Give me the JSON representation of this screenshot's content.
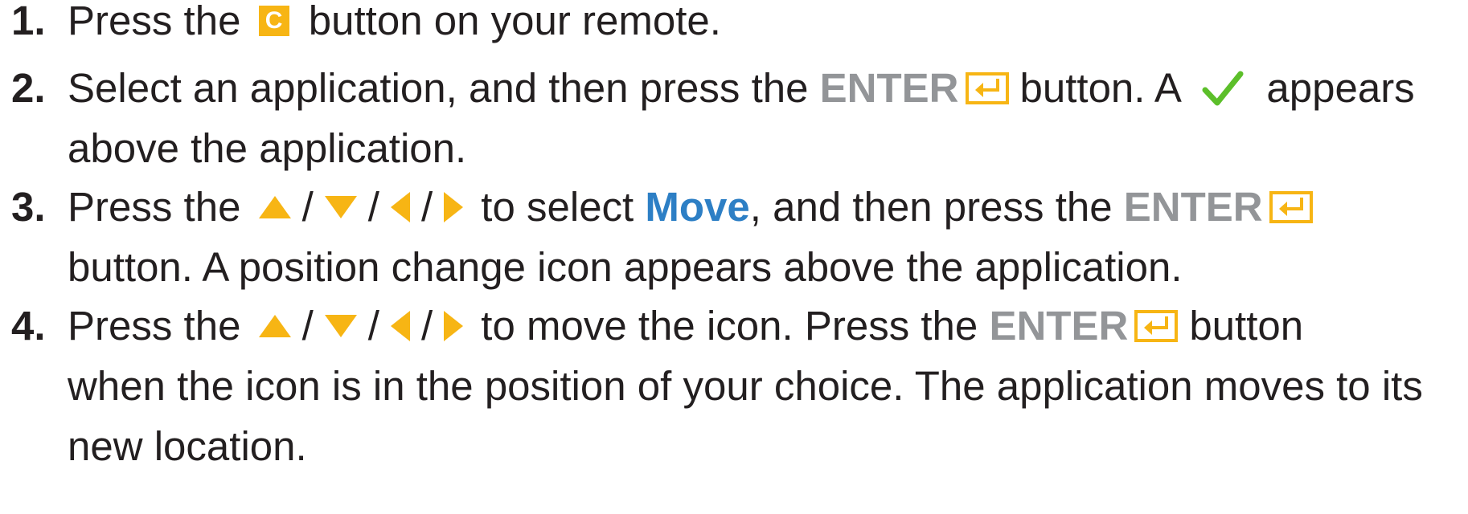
{
  "steps": [
    {
      "number": "1.",
      "text_before_key": "Press the",
      "color_key_label": "C",
      "text_after_key": "button on your remote."
    },
    {
      "number": "2.",
      "text_before_enter": "Select an application, and then press the",
      "enter_label": "ENTER",
      "text_after_enter": "button. A",
      "text_after_check": "appears",
      "line2": "above the application."
    },
    {
      "number": "3.",
      "text_start": "Press the",
      "separator": "/",
      "text_select": "to select",
      "move_label": "Move",
      "text_after_move": ", and then press the",
      "enter_label": "ENTER",
      "line2": "button. A position change icon appears above the application."
    },
    {
      "number": "4.",
      "text_start": "Press the",
      "separator": "/",
      "text_after_arrows": "to move the icon. Press the",
      "enter_label": "ENTER",
      "text_after_enter": "button",
      "line2": "when the icon is in the position of your choice. The application moves to its",
      "line3": "new location."
    }
  ],
  "icons": {
    "color_key": "c-color-key-icon",
    "enter": "enter-key-icon",
    "check": "checkmark-icon",
    "up": "arrow-up-icon",
    "down": "arrow-down-icon",
    "left": "arrow-left-icon",
    "right": "arrow-right-icon"
  },
  "colors": {
    "text": "#231f20",
    "enter_text": "#939598",
    "move_text": "#2d7fc5",
    "key_yellow": "#f7b514",
    "check_green": "#5cbf2a"
  }
}
